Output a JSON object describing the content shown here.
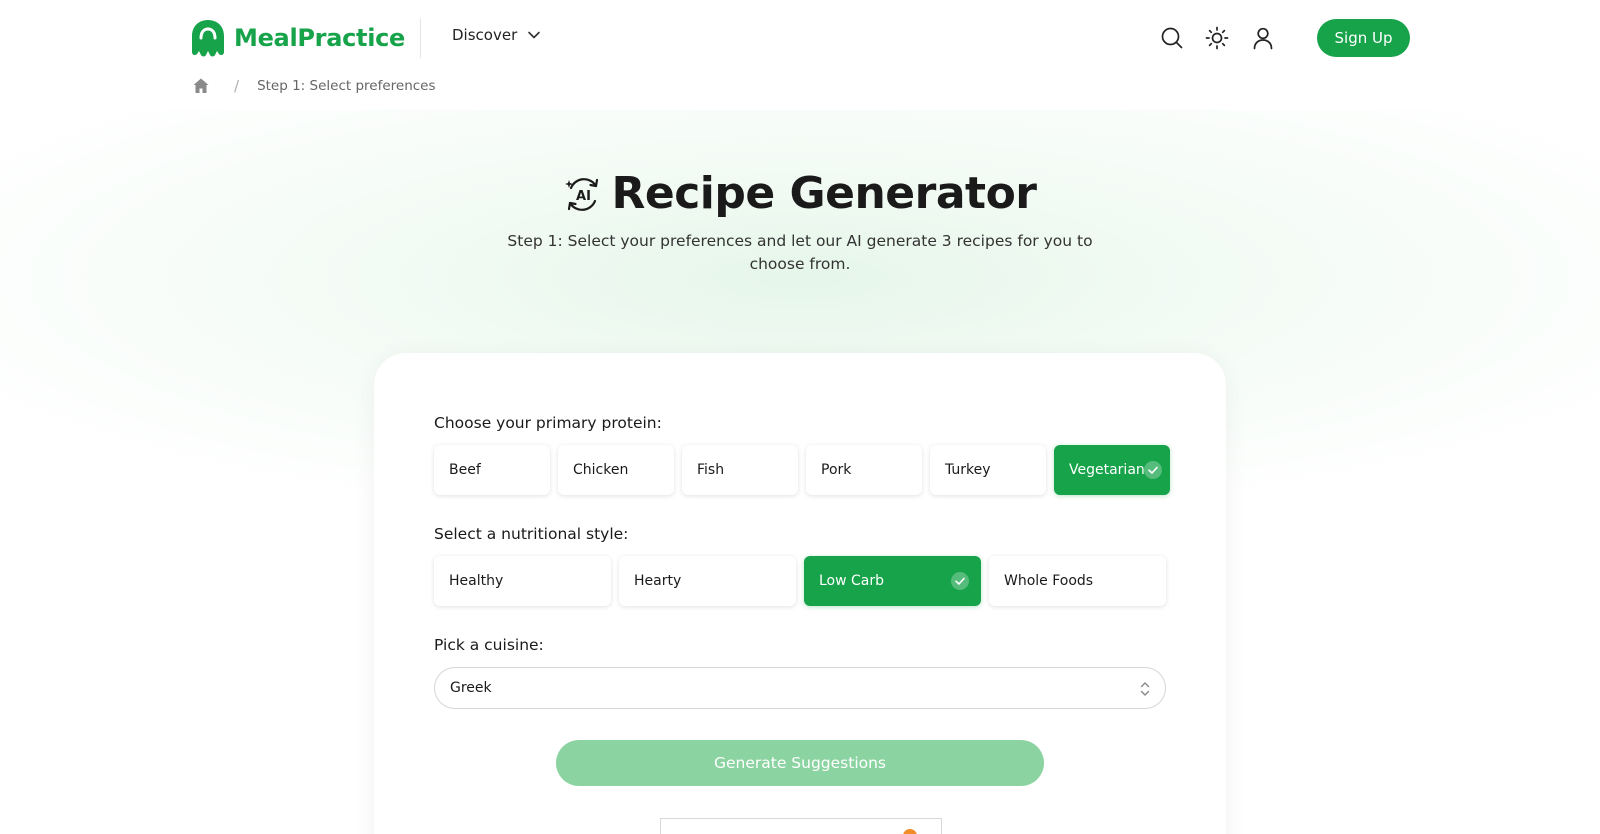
{
  "header": {
    "brand": "MealPractice",
    "nav_discover": "Discover",
    "sign_up": "Sign Up",
    "icons": [
      "search-icon",
      "theme-sun-icon",
      "user-icon"
    ]
  },
  "breadcrumb": {
    "current": "Step 1: Select preferences"
  },
  "hero": {
    "title": "Recipe Generator",
    "subtitle": "Step 1: Select your preferences and let our AI generate 3 recipes for you to choose from."
  },
  "form": {
    "protein_label": "Choose your primary protein:",
    "proteins": [
      "Beef",
      "Chicken",
      "Fish",
      "Pork",
      "Turkey",
      "Vegetarian"
    ],
    "protein_selected": "Vegetarian",
    "style_label": "Select a nutritional style:",
    "styles": [
      "Healthy",
      "Hearty",
      "Low Carb",
      "Whole Foods"
    ],
    "style_selected": "Low Carb",
    "cuisine_label": "Pick a cuisine:",
    "cuisine_value": "Greek",
    "generate_label": "Generate Suggestions"
  },
  "colors": {
    "brand_green": "#16a34a",
    "disabled_green": "#8bd3a0",
    "accent_orange": "#f28c28"
  }
}
